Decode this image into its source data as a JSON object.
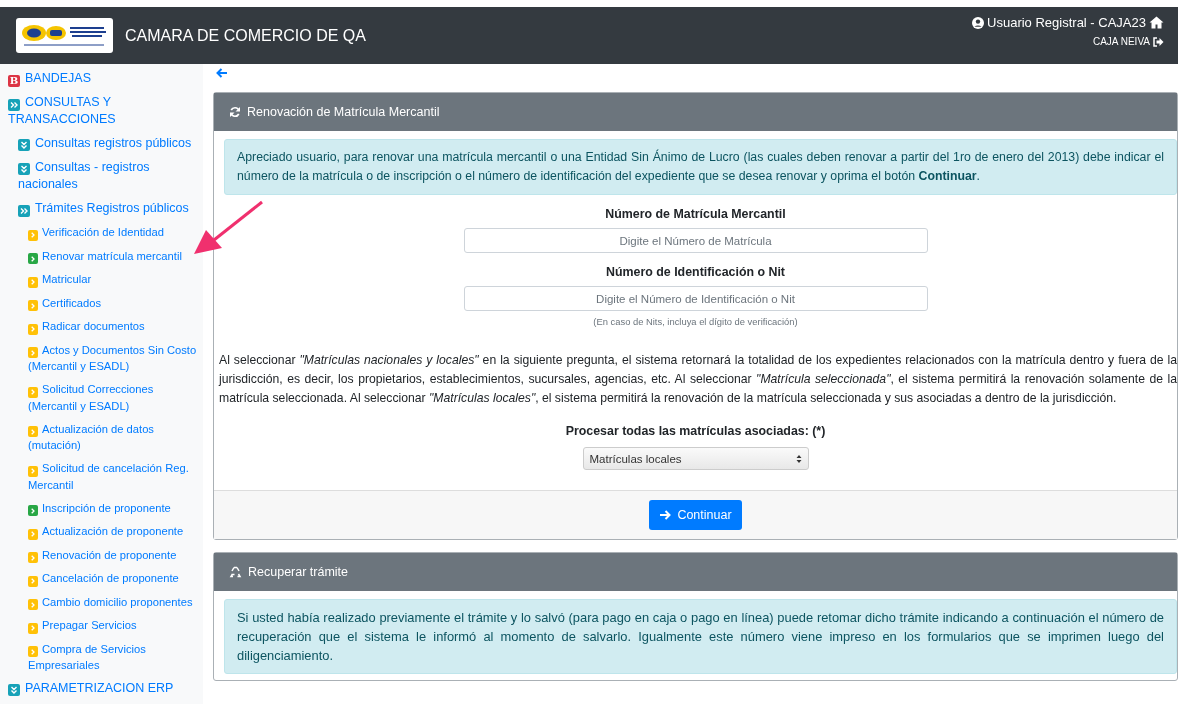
{
  "header": {
    "title": "CAMARA DE COMERCIO DE QA",
    "user": "Usuario Registral - CAJA23",
    "office": "CAJA NEIVA"
  },
  "sidebar": {
    "items": [
      {
        "label": "BANDEJAS",
        "kind": "letter",
        "icon_text": "B",
        "color": "#dc3545"
      },
      {
        "label": "CONSULTAS Y TRANSACCIONES",
        "kind": "expand",
        "color": "#17a2b8",
        "children": [
          {
            "label": "Consultas registros públicos",
            "kind": "collapse",
            "color": "#17a2b8"
          },
          {
            "label": "Consultas - registros nacionales",
            "kind": "collapse",
            "color": "#17a2b8"
          },
          {
            "label": "Trámites Registros públicos",
            "kind": "expand",
            "color": "#17a2b8",
            "children": [
              {
                "label": "Verificación de Identidad",
                "kind": "leaf",
                "color": "#ffc107"
              },
              {
                "label": "Renovar matrícula mercantil",
                "kind": "leaf",
                "color": "#28a745"
              },
              {
                "label": "Matricular",
                "kind": "leaf",
                "color": "#ffc107"
              },
              {
                "label": "Certificados",
                "kind": "leaf",
                "color": "#ffc107"
              },
              {
                "label": "Radicar documentos",
                "kind": "leaf",
                "color": "#ffc107"
              },
              {
                "label": "Actos y Documentos Sin Costo (Mercantil y ESADL)",
                "kind": "leaf",
                "color": "#ffc107"
              },
              {
                "label": "Solicitud Correcciones (Mercantil y ESADL)",
                "kind": "leaf",
                "color": "#ffc107"
              },
              {
                "label": "Actualización de datos (mutación)",
                "kind": "leaf",
                "color": "#ffc107"
              },
              {
                "label": "Solicitud de cancelación Reg. Mercantil",
                "kind": "leaf",
                "color": "#ffc107"
              },
              {
                "label": "Inscripción de proponente",
                "kind": "leaf",
                "color": "#28a745"
              },
              {
                "label": "Actualización de proponente",
                "kind": "leaf",
                "color": "#ffc107"
              },
              {
                "label": "Renovación de proponente",
                "kind": "leaf",
                "color": "#ffc107"
              },
              {
                "label": "Cancelación de proponente",
                "kind": "leaf",
                "color": "#ffc107"
              },
              {
                "label": "Cambio domicilio proponentes",
                "kind": "leaf",
                "color": "#ffc107"
              },
              {
                "label": "Prepagar Servicios",
                "kind": "leaf",
                "color": "#ffc107"
              },
              {
                "label": "Compra de Servicios Empresariales",
                "kind": "leaf",
                "color": "#ffc107"
              }
            ]
          }
        ]
      },
      {
        "label": "PARAMETRIZACION ERP",
        "kind": "collapse",
        "color": "#17a2b8"
      }
    ]
  },
  "renewal_card": {
    "title": "Renovación de Matrícula Mercantil",
    "info": "Apreciado usuario, para renovar una matrícula mercantil o una Entidad Sin Ánimo de Lucro (las cuales deben renovar a partir del 1ro de enero del 2013) debe indicar el número de la matrícula o de inscripción o el número de identificación del expediente que se desea renovar y oprima el botón **Continuar**.",
    "fields": [
      {
        "label": "Número de Matrícula Mercantil",
        "placeholder": "Digite el Número de Matrícula"
      },
      {
        "label": "Número de Identificación o Nit",
        "placeholder": "Digite el Número de Identificación o Nit",
        "hint": "(En caso de Nits, incluya el dígito de verificación)"
      }
    ],
    "explanation": "Al seleccionar *\"Matrículas nacionales y locales\"* en la siguiente pregunta, el sistema retornará la totalidad de los expedientes relacionados con la matrícula dentro y fuera de la jurisdicción, es decir, los propietarios, establecimientos, sucursales, agencias, etc. Al seleccionar *\"Matrícula seleccionada\"*, el sistema permitirá la renovación solamente de la matrícula seleccionada. Al seleccionar *\"Matrículas locales\"*, el sistema permitirá la renovación de la matrícula seleccionada y sus asociadas a dentro de la jurisdicción.",
    "select_label": "Procesar todas las matrículas asociadas: (*)",
    "select_value": "Matrículas locales",
    "button": "Continuar"
  },
  "recover_card": {
    "title": "Recuperar trámite",
    "info": "Si usted había realizado previamente el trámite y lo salvó (para pago en caja o pago en línea) puede retomar dicho trámite indicando a continuación el número de recuperación que el sistema le informó al momento de salvarlo. Igualmente este número viene impreso en los formularios que se imprimen luego del diligenciamiento."
  }
}
